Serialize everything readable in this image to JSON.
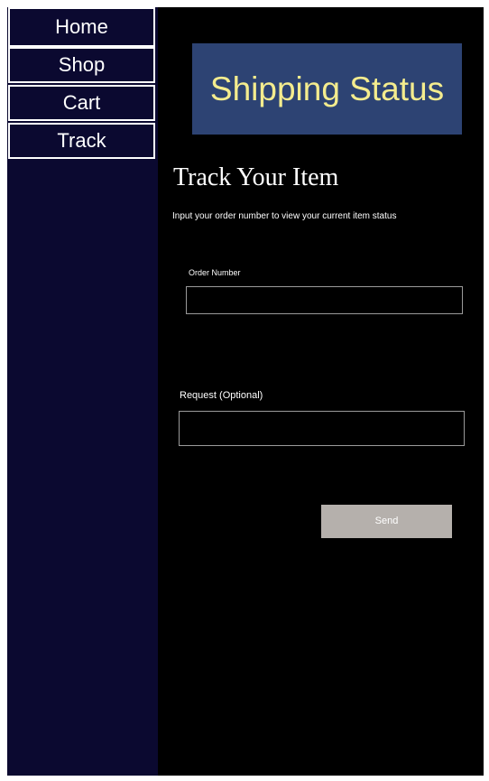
{
  "nav": {
    "items": [
      {
        "label": "Home"
      },
      {
        "label": "Shop"
      },
      {
        "label": "Cart"
      },
      {
        "label": "Track"
      }
    ]
  },
  "banner": {
    "title": "Shipping Status"
  },
  "form": {
    "title": "Track Your Item",
    "subtitle": "Input your order number to view your current item status",
    "order_number": {
      "label": "Order Number",
      "value": "",
      "placeholder": ""
    },
    "request": {
      "label": "Request (Optional)",
      "value": "",
      "placeholder": ""
    },
    "send_label": "Send"
  },
  "colors": {
    "sidebar": "#0b0930",
    "page": "#000000",
    "banner_bg": "#2d4373",
    "banner_text": "#f4ec8e",
    "button_bg": "#b5b0ac"
  }
}
